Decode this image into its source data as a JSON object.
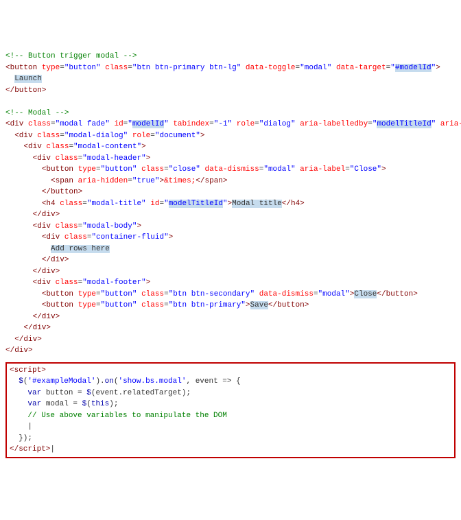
{
  "comment_trigger": "<!-- Button trigger modal -->",
  "btn_open": "<button ",
  "type_attr": "type",
  "type_val": "\"button\"",
  "class_attr": "class",
  "btn_class_val": "\"btn btn-primary btn-lg\"",
  "data_toggle_attr": "data-toggle",
  "data_toggle_val": "\"modal\"",
  "data_target_attr": "data-target",
  "data_target_val": "\"#modelId\"",
  "gt": ">",
  "launch_text": "Launch",
  "btn_close_tag": "</button>",
  "comment_modal": "<!-- Modal -->",
  "div_open": "<div ",
  "modal_class_val": "\"modal fade\"",
  "id_attr": "id",
  "model_id_val": "\"modelId\"",
  "tabindex_attr": "tabindex",
  "tabindex_val": "\"-1\"",
  "role_attr": "role",
  "role_dialog_val": "\"dialog\"",
  "aria_labelledby_attr": "aria-labelledby",
  "aria_labelledby_val": "\"modelTitleId\"",
  "aria_hidden_attr": "aria-hidden",
  "aria_hidden_val": "\"true\"",
  "dialog_class_val": "\"modal-dialog\"",
  "role_doc_val": "\"document\"",
  "content_class_val": "\"modal-content\"",
  "header_class_val": "\"modal-header\"",
  "close_class_val": "\"close\"",
  "data_dismiss_attr": "data-dismiss",
  "data_dismiss_val": "\"modal\"",
  "aria_label_attr": "aria-label",
  "aria_label_val": "\"Close\"",
  "span_open": "<span ",
  "span_aria_val": "\"true\"",
  "times_entity": "&times;",
  "span_close": "</span>",
  "h4_open": "<h4 ",
  "title_class_val": "\"modal-title\"",
  "title_id_val": "\"modelTitleId\"",
  "modal_title_text": "Modal title",
  "h4_close": "</h4>",
  "div_close": "</div>",
  "body_class_val": "\"modal-body\"",
  "container_class_val": "\"container-fluid\"",
  "add_rows_text": "Add rows here",
  "footer_class_val": "\"modal-footer\"",
  "secondary_class_val": "\"btn btn-secondary\"",
  "close_text": "Close",
  "primary_class_val": "\"btn btn-primary\"",
  "save_text": "Save",
  "script_open": "<script>",
  "jq_line": "  $('#exampleModal').on('show.bs.modal', event => {",
  "var_button_pre": "    var button = ",
  "jq_event": "$(event.relatedTarget)",
  "semicolon": ";",
  "var_modal_pre": "    var modal = ",
  "jq_this": "$(this)",
  "dom_comment": "    // Use above variables to manipulate the DOM",
  "cursor_line": "    |",
  "close_brace": "  });",
  "script_close_tag": "</script>"
}
